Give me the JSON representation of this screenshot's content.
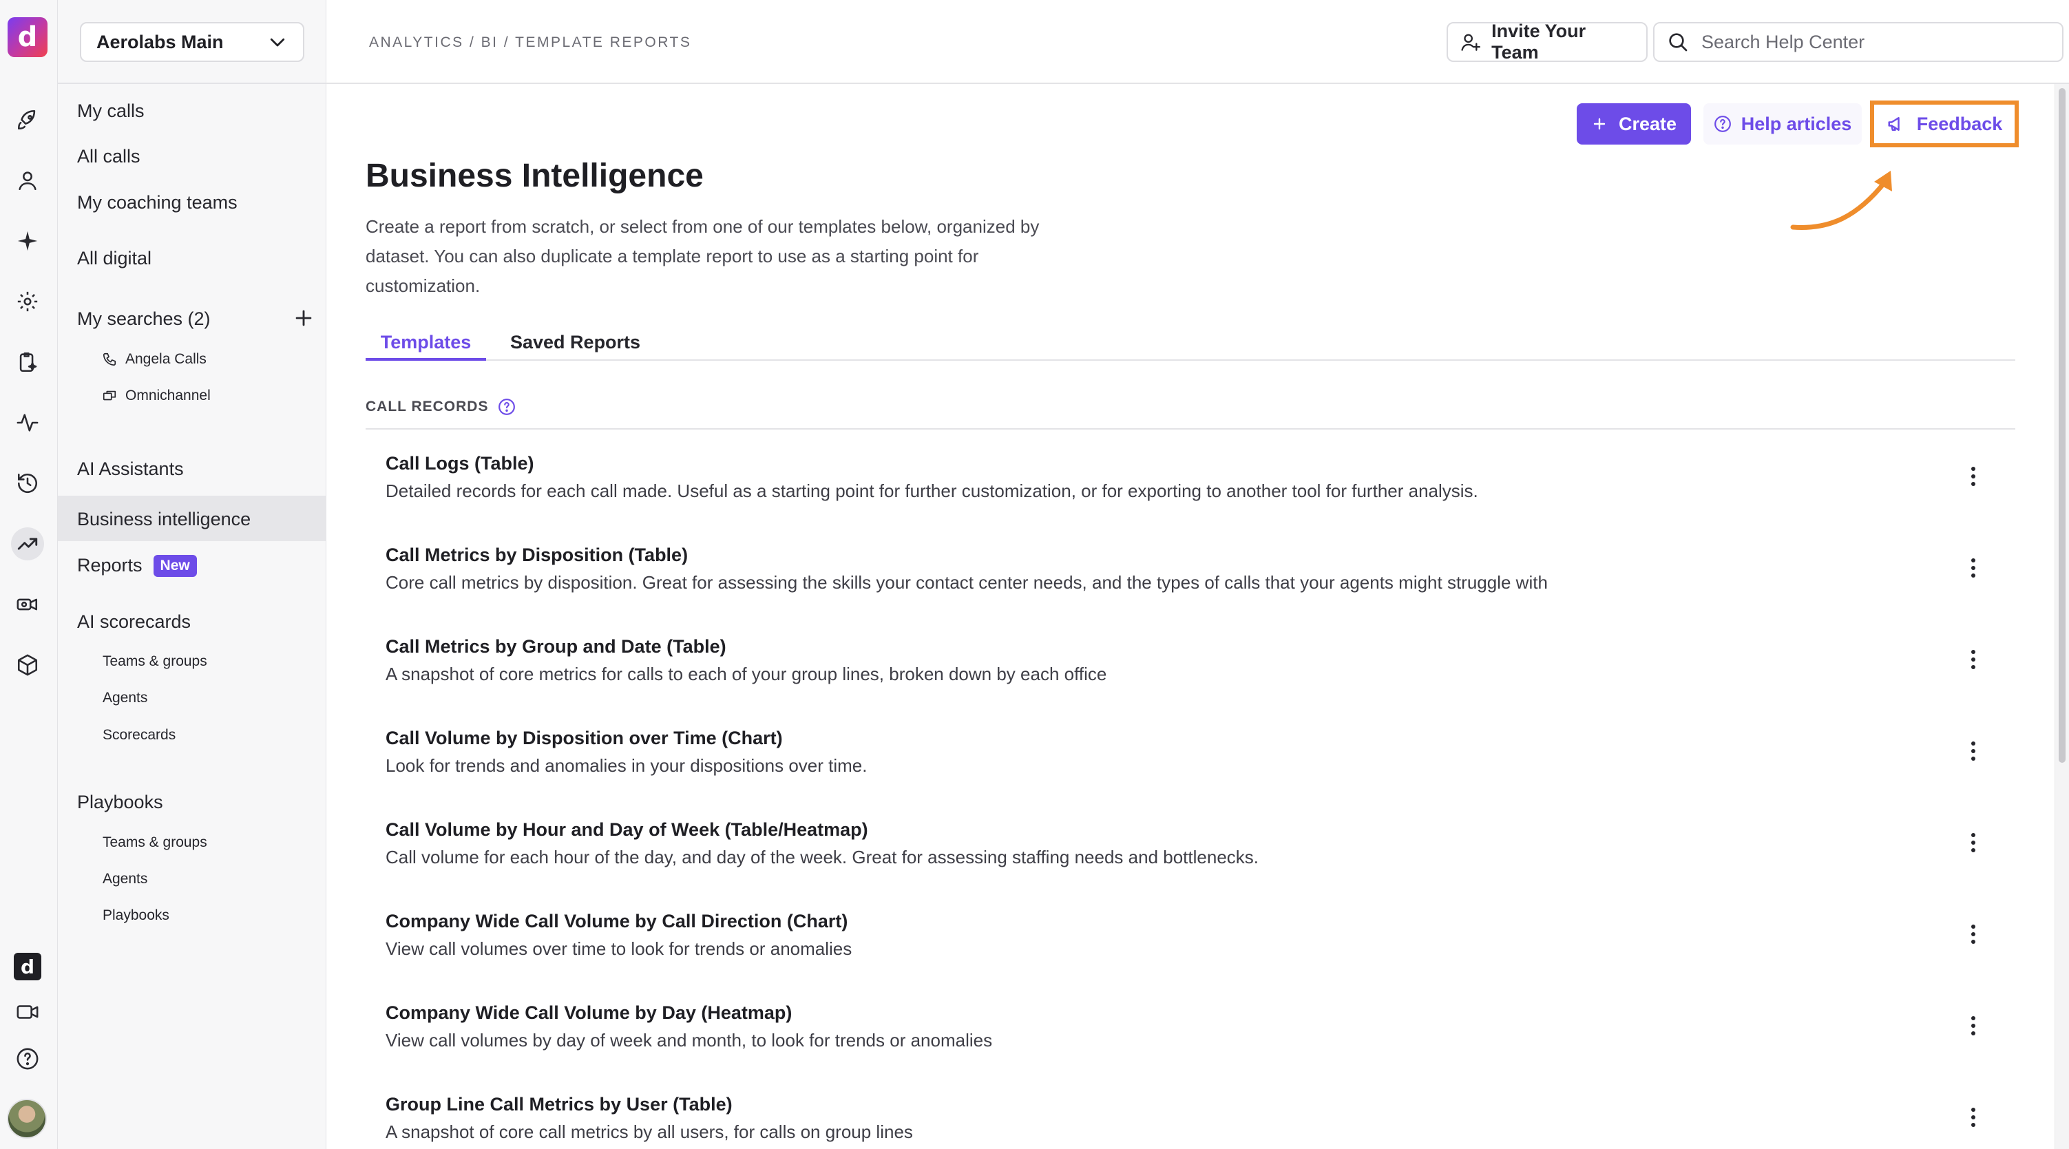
{
  "workspace": {
    "name": "Aerolabs Main"
  },
  "rail": {
    "logo_text": "d",
    "icons": [
      "rocket-icon",
      "person-icon",
      "sparkle-icon",
      "gear-icon",
      "clipboard-sparkle-icon",
      "activity-icon",
      "history-icon",
      "trending-up-icon",
      "video-ai-icon",
      "cube-icon",
      "dialpad-logo-icon",
      "video-icon",
      "help-icon",
      "avatar"
    ]
  },
  "sidebar": {
    "my_calls": "My calls",
    "all_calls": "All calls",
    "my_coaching_teams": "My coaching teams",
    "all_digital": "All digital",
    "my_searches": "My searches (2)",
    "searches": [
      "Angela Calls",
      "Omnichannel"
    ],
    "ai_assistants": "AI Assistants",
    "business_intelligence": "Business intelligence",
    "reports": "Reports",
    "reports_badge": "New",
    "ai_scorecards": "AI scorecards",
    "scorecards_items": [
      "Teams & groups",
      "Agents",
      "Scorecards"
    ],
    "playbooks": "Playbooks",
    "playbooks_items": [
      "Teams & groups",
      "Agents",
      "Playbooks"
    ]
  },
  "header": {
    "breadcrumb": "ANALYTICS / BI / TEMPLATE REPORTS",
    "invite_label": "Invite Your Team",
    "search_placeholder": "Search Help Center"
  },
  "actions": {
    "create_label": "Create",
    "help_label": "Help articles",
    "feedback_label": "Feedback"
  },
  "page": {
    "title": "Business Intelligence",
    "description": "Create a report from scratch, or select from one of our templates below, organized by dataset. You can also duplicate a template report to use as a starting point for customization."
  },
  "tabs": {
    "templates": "Templates",
    "saved_reports": "Saved Reports"
  },
  "section": {
    "label": "CALL RECORDS"
  },
  "reports": [
    {
      "title": "Call Logs (Table)",
      "desc": "Detailed records for each call made. Useful as a starting point for further customization, or for exporting to another tool for further analysis."
    },
    {
      "title": "Call Metrics by Disposition (Table)",
      "desc": "Core call metrics by disposition. Great for assessing the skills your contact center needs, and the types of calls that your agents might struggle with"
    },
    {
      "title": "Call Metrics by Group and Date (Table)",
      "desc": "A snapshot of core metrics for calls to each of your group lines, broken down by each office"
    },
    {
      "title": "Call Volume by Disposition over Time (Chart)",
      "desc": "Look for trends and anomalies in your dispositions over time."
    },
    {
      "title": "Call Volume by Hour and Day of Week (Table/Heatmap)",
      "desc": "Call volume for each hour of the day, and day of the week. Great for assessing staffing needs and bottlenecks."
    },
    {
      "title": "Company Wide Call Volume by Call Direction (Chart)",
      "desc": "View call volumes over time to look for trends or anomalies"
    },
    {
      "title": "Company Wide Call Volume by Day (Heatmap)",
      "desc": "View call volumes by day of week and month, to look for trends or anomalies"
    },
    {
      "title": "Group Line Call Metrics by User (Table)",
      "desc": "A snapshot of core call metrics by all users, for calls on group lines"
    }
  ],
  "colors": {
    "accent": "#6d4ce8",
    "annotation": "#ef8d2c"
  }
}
